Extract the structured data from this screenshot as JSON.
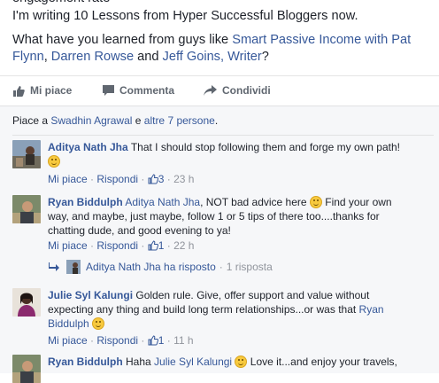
{
  "post": {
    "cut_line": "engagement rate",
    "line1": "I'm writing 10 Lessons from Hyper Successful Bloggers now.",
    "q_pre": "What have you learned from guys like ",
    "link1": "Smart Passive Income with Pat Flynn",
    "sep1": ", ",
    "link2": "Darren Rowse",
    "and": " and ",
    "link3": "Jeff Goins, Writer",
    "q_end": "?"
  },
  "actions": {
    "like": "Mi piace",
    "comment": "Commenta",
    "share": "Condividi"
  },
  "likes_line": {
    "pre": "Piace a ",
    "name": "Swadhin Agrawal",
    "mid": " e ",
    "others": "altre 7 persone",
    "end": "."
  },
  "comments": [
    {
      "author": "Aditya Nath Jha",
      "text": "That I should stop following them and forge my own path!",
      "like": "Mi piace",
      "reply": "Rispondi",
      "likes": "3",
      "time": "23 h"
    },
    {
      "author": "Ryan Biddulph",
      "mention": "Aditya Nath Jha",
      "text": ", NOT bad advice here ",
      "text2": " Find your own way, and maybe, just maybe, follow 1 or 5 tips of there too....thanks for chatting dude, and good evening to ya!",
      "like": "Mi piace",
      "reply": "Rispondi",
      "likes": "1",
      "time": "22 h"
    },
    {
      "author": "Julie Syl Kalungi",
      "text": "Golden rule. Give, offer support and value without expecting any thing and build long term relationships...or was that ",
      "mention": "Ryan Biddulph",
      "like": "Mi piace",
      "reply": "Rispondi",
      "likes": "1",
      "time": "11 h"
    },
    {
      "author": "Ryan Biddulph",
      "text": "Haha ",
      "mention": "Julie Syl Kalungi",
      "text2": " Love it...and enjoy your travels,"
    }
  ],
  "reply_thread": {
    "text": "Aditya Nath Jha ha risposto",
    "sep": " · ",
    "count": "1 risposta"
  },
  "meta_sep": " · "
}
